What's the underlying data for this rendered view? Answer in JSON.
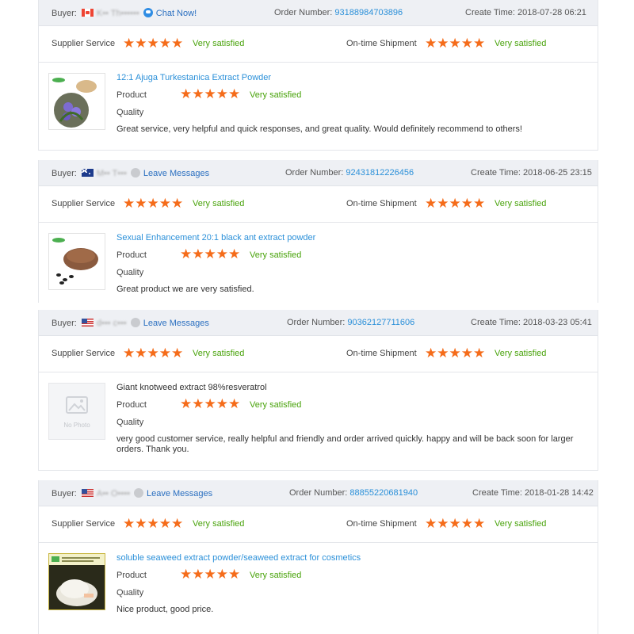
{
  "colors": {
    "star": "#f56c1a",
    "satisfied": "#49a30b",
    "link": "#2b90d9",
    "header_bg": "#eef0f4"
  },
  "labels": {
    "buyer": "Buyer:",
    "order_number": "Order Number:",
    "create_time": "Create Time:",
    "supplier_service": "Supplier Service",
    "ontime_shipment": "On-time Shipment",
    "product": "Product",
    "quality": "Quality",
    "no_photo": "No Photo",
    "stars": "★★★★★"
  },
  "reviews": [
    {
      "buyer_name": "K•• Th••••••",
      "country_flag": "canada-flag",
      "contact_label": "Chat Now!",
      "order_number": "93188984703896",
      "create_time": "2018-07-28 06:21",
      "supplier_service_rating": 5,
      "supplier_service_text": "Very satisfied",
      "shipment_rating": 5,
      "shipment_text": "Very satisfied",
      "product_title": "12:1 Ajuga Turkestanica Extract Powder",
      "product_rating": 5,
      "product_text": "Very satisfied",
      "review": "Great service, very helpful and quick responses, and great quality. Would definitely recommend to others!"
    },
    {
      "buyer_name": "M•• T•••",
      "country_flag": "australia-flag",
      "contact_label": "Leave Messages",
      "order_number": "92431812226456",
      "create_time": "2018-06-25 23:15",
      "supplier_service_rating": 5,
      "supplier_service_text": "Very satisfied",
      "shipment_rating": 5,
      "shipment_text": "Very satisfied",
      "product_title": "Sexual Enhancement 20:1 black ant extract powder",
      "product_rating": 5,
      "product_text": "Very satisfied",
      "review": "Great product we are very satisfied."
    },
    {
      "buyer_name": "d••• c•••",
      "country_flag": "usa-flag",
      "contact_label": "Leave Messages",
      "order_number": "90362127711606",
      "create_time": "2018-03-23 05:41",
      "supplier_service_rating": 5,
      "supplier_service_text": "Very satisfied",
      "shipment_rating": 5,
      "shipment_text": "Very satisfied",
      "product_title": "Giant knotweed extract 98%resveratrol",
      "product_rating": 5,
      "product_text": "Very satisfied",
      "review": "very good customer service, really helpful and friendly and order arrived quickly. happy and will be back soon for larger orders. Thank you."
    },
    {
      "buyer_name": "A•• O••••",
      "country_flag": "usa-flag",
      "contact_label": "Leave Messages",
      "order_number": "88855220681940",
      "create_time": "2018-01-28 14:42",
      "supplier_service_rating": 5,
      "supplier_service_text": "Very satisfied",
      "shipment_rating": 5,
      "shipment_text": "Very satisfied",
      "product_title": "soluble seaweed extract powder/seaweed extract for cosmetics",
      "product_rating": 5,
      "product_text": "Very satisfied",
      "review": "Nice product, good price."
    }
  ]
}
